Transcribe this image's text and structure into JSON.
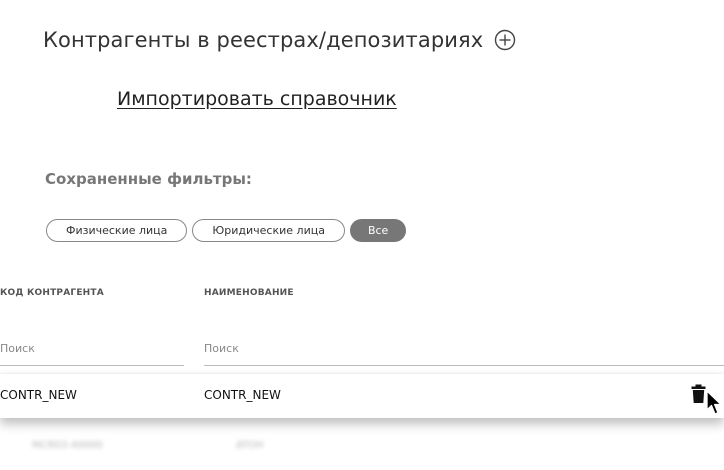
{
  "header": {
    "title": "Контрагенты в реестрах/депозитариях",
    "add_icon": "plus-circle-icon",
    "import_link": "Импортировать справочник"
  },
  "filters": {
    "label": "Сохраненные фильтры:",
    "chips": [
      {
        "label": "Физические лица",
        "active": false
      },
      {
        "label": "Юридические лица",
        "active": false
      },
      {
        "label": "Все",
        "active": true
      }
    ]
  },
  "table": {
    "columns": [
      "КОД КОНТРАГЕНТА",
      "НАИМЕНОВАНИЕ"
    ],
    "search_placeholders": [
      "Поиск",
      "Поиск"
    ],
    "rows": [
      {
        "code": "CONTR_NEW",
        "name": "CONTR_NEW",
        "action_icon": "trash-icon"
      }
    ],
    "blurred_row": {
      "code": "MCR03-40000",
      "name": "ATOH"
    }
  },
  "colors": {
    "active_chip": "#777777",
    "text": "#333333"
  }
}
